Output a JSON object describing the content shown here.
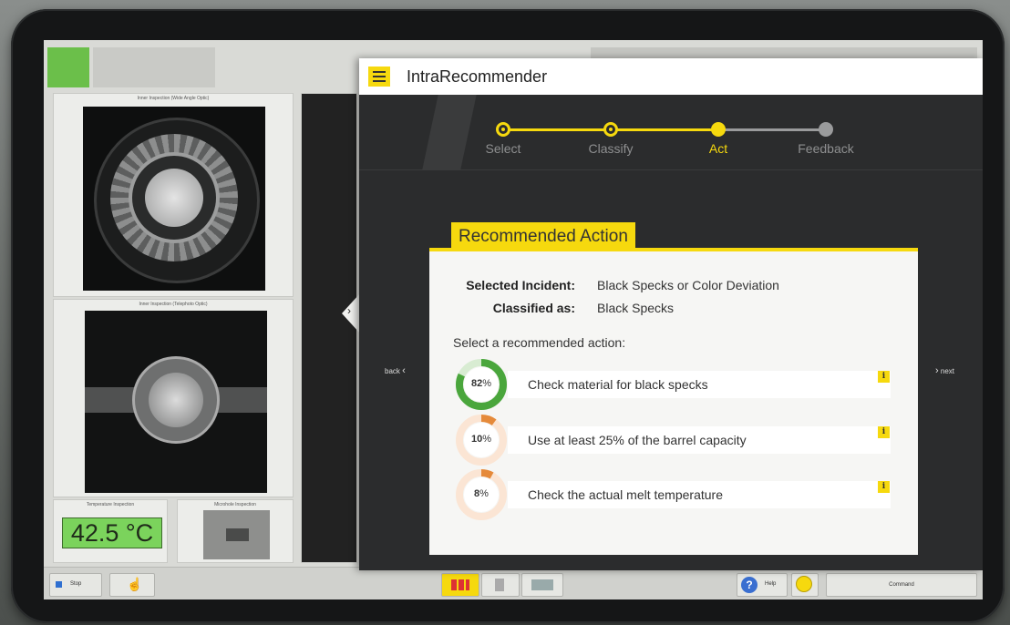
{
  "background_hmi": {
    "panels": {
      "wide_angle_caption": "Inner Inspection (Wide Angle Optic)",
      "telephoto_caption": "Inner Inspection (Telephoto Optic)",
      "temperature_caption": "Temperature Inspection",
      "microhole_caption": "Microhole Inspection"
    },
    "temperature_value": "42.5 °C",
    "bottom_bar": {
      "stop_label": "Stop",
      "help_label": "Help",
      "command_label": "Command"
    }
  },
  "overlay": {
    "title": "IntraRecommender",
    "menu_icon": "hamburger-icon",
    "steps": [
      {
        "label": "Select",
        "state": "done"
      },
      {
        "label": "Classify",
        "state": "done"
      },
      {
        "label": "Act",
        "state": "active"
      },
      {
        "label": "Feedback",
        "state": "todo"
      }
    ],
    "card": {
      "tag": "Recommended Action",
      "selected_incident_label": "Selected Incident:",
      "selected_incident_value": "Black Specks or Color Deviation",
      "classified_label": "Classified as:",
      "classified_value": "Black Specks",
      "prompt": "Select a recommended action:",
      "actions": [
        {
          "pct_num": "82",
          "pct_sign": "%",
          "fraction": 0.82,
          "text": "Check material for black specks",
          "color": "#4aa63c",
          "track": "#d8ecd2"
        },
        {
          "pct_num": "10",
          "pct_sign": "%",
          "fraction": 0.1,
          "text": "Use at least 25% of the barrel capacity",
          "color": "#e58a3a",
          "track": "#fbe5d4"
        },
        {
          "pct_num": "8",
          "pct_sign": "%",
          "fraction": 0.08,
          "text": "Check the actual melt temperature",
          "color": "#e58a3a",
          "track": "#fbe5d4"
        }
      ],
      "info_glyph": "i"
    },
    "nav": {
      "back_label": "back",
      "next_label": "next"
    }
  },
  "colors": {
    "accent_yellow": "#f6d90e",
    "overlay_bg": "#2b2c2d",
    "temp_green": "#7bd35c"
  }
}
